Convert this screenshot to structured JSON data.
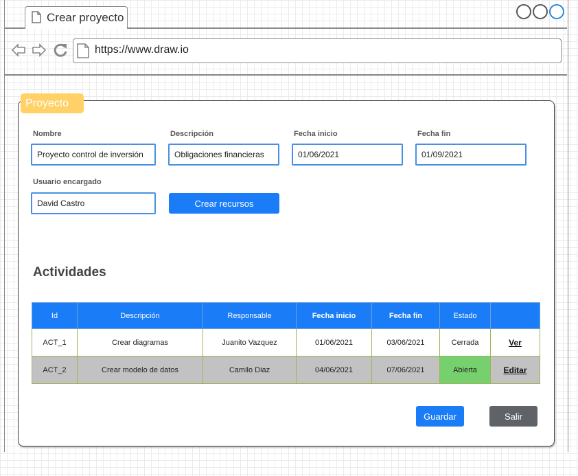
{
  "browser": {
    "tab_title": "Crear proyecto",
    "url": "https://www.draw.io"
  },
  "panel": {
    "title": "Proyecto",
    "fields": {
      "nombre": {
        "label": "Nombre",
        "value": "Proyecto control de inversión"
      },
      "descripcion": {
        "label": "Descripción",
        "value": "Obligaciones financieras"
      },
      "fecha_inicio": {
        "label": "Fecha inicio",
        "value": "01/06/2021"
      },
      "fecha_fin": {
        "label": "Fecha fin",
        "value": "01/09/2021"
      },
      "usuario": {
        "label": "Usuario encargado",
        "value": "David Castro"
      }
    },
    "crear_recursos_label": "Crear recursos",
    "activities_title": "Actividades",
    "table": {
      "headers": [
        "Id",
        "Descripción",
        "Responsable",
        "Fecha inicio",
        "Fecha fin",
        "Estado",
        ""
      ],
      "rows": [
        [
          "ACT_1",
          "Crear diagramas",
          "Juanito Vazquez",
          "01/06/2021",
          "03/06/2021",
          "Cerrada",
          "Ver"
        ],
        [
          "ACT_2",
          "Crear modelo de datos",
          "Camilo Diaz",
          "04/06/2021",
          "07/06/2021",
          "Abierta",
          "Editar"
        ]
      ]
    },
    "guardar_label": "Guardar",
    "salir_label": "Salir"
  },
  "colors": {
    "primary": "#1a7cf6",
    "secondary": "#5f6368",
    "tag": "#ffd166",
    "open_status": "#77d06e",
    "row_alt": "#c2c2c2"
  }
}
